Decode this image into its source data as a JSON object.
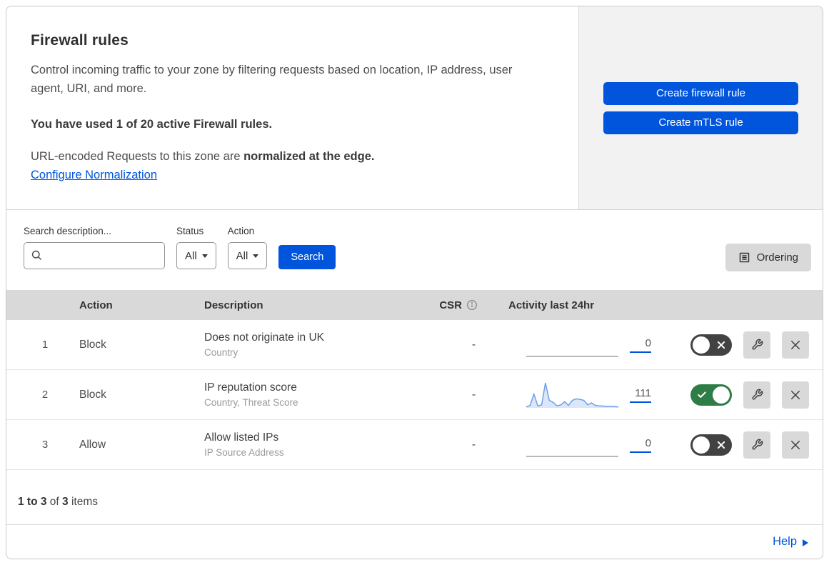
{
  "colors": {
    "accent_blue": "#0055dc",
    "toggle_on_green": "#2e7d46",
    "toggle_off_gray": "#424242",
    "sparkline_line": "#6d9eea",
    "sparkline_fill": "#dbe7f8",
    "table_header_bg": "#d9d9d9",
    "side_panel_bg": "#f2f2f2",
    "gray_button_bg": "#d9d9d9"
  },
  "header": {
    "title": "Firewall rules",
    "description": "Control incoming traffic to your zone by filtering requests based on location, IP address, user agent, URI, and more.",
    "usage": "You have used 1 of 20 active Firewall rules.",
    "normalization_prefix": "URL-encoded Requests to this zone are ",
    "normalization_bold": "normalized at the edge.",
    "configure_link": "Configure Normalization",
    "buttons": [
      {
        "label": "Create firewall rule"
      },
      {
        "label": "Create mTLS rule"
      }
    ]
  },
  "filters": {
    "search_label": "Search description...",
    "search_value": "",
    "status_label": "Status",
    "status_value": "All",
    "action_label": "Action",
    "action_value": "All",
    "search_button": "Search",
    "ordering_button": "Ordering"
  },
  "table": {
    "columns": {
      "action": "Action",
      "description": "Description",
      "csr": "CSR",
      "activity": "Activity last 24hr"
    },
    "rows": [
      {
        "index": "1",
        "action": "Block",
        "description": "Does not originate in UK",
        "criteria": "Country",
        "csr": "-",
        "activity_count": "0",
        "enabled": false,
        "has_sparkline": false
      },
      {
        "index": "2",
        "action": "Block",
        "description": "IP reputation score",
        "criteria": "Country, Threat Score",
        "csr": "-",
        "activity_count": "111",
        "enabled": true,
        "has_sparkline": true
      },
      {
        "index": "3",
        "action": "Allow",
        "description": "Allow listed IPs",
        "criteria": "IP Source Address",
        "csr": "-",
        "activity_count": "0",
        "enabled": false,
        "has_sparkline": false
      }
    ],
    "footer": {
      "range": "1 to 3",
      "of_word": "of",
      "total": "3",
      "items_word": "items"
    }
  },
  "help": {
    "label": "Help"
  },
  "chart_data": {
    "type": "area",
    "title": "Activity last 24hr sparkline (rule 2)",
    "xlabel": "last 24 hours (no tick labels shown)",
    "ylabel": "requests (relative height %, no axis shown)",
    "ylim": [
      0,
      100
    ],
    "grid": false,
    "legend": false,
    "values": [
      4,
      10,
      55,
      8,
      12,
      100,
      30,
      22,
      8,
      12,
      25,
      10,
      30,
      36,
      34,
      30,
      12,
      20,
      10,
      8,
      7,
      6,
      6,
      5,
      4
    ],
    "total_requests_label": "111"
  }
}
